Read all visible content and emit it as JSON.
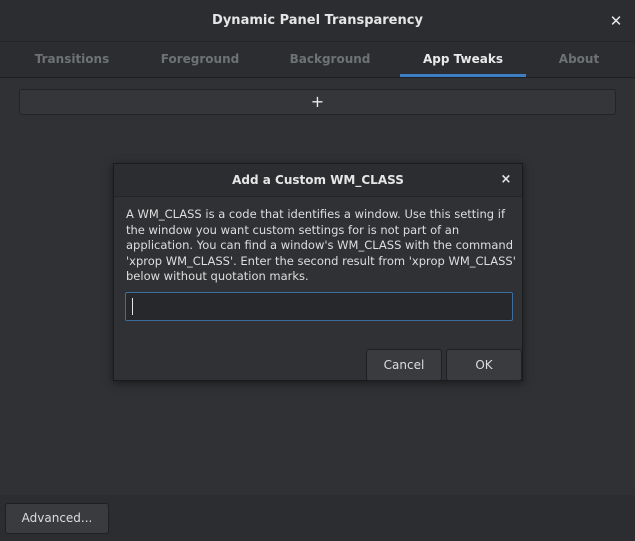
{
  "window": {
    "title": "Dynamic Panel Transparency",
    "close_icon": "close-icon"
  },
  "tabs": [
    {
      "label": "Transitions",
      "active": false
    },
    {
      "label": "Foreground",
      "active": false
    },
    {
      "label": "Background",
      "active": false
    },
    {
      "label": "App Tweaks",
      "active": true
    },
    {
      "label": "About",
      "active": false
    }
  ],
  "content": {
    "add_label": "+"
  },
  "dialog": {
    "title": "Add a Custom WM_CLASS",
    "close_label": "×",
    "message": "A WM_CLASS is a code that identifies a window. Use this setting if the window you want custom settings for is not part of an application. You can find a window's WM_CLASS with the command 'xprop WM_CLASS'. Enter the second result from 'xprop WM_CLASS' below without quotation marks.",
    "input_value": "",
    "input_placeholder": "",
    "cancel_label": "Cancel",
    "ok_label": "OK"
  },
  "footer": {
    "advanced_label": "Advanced..."
  },
  "colors": {
    "accent": "#3e7fc4",
    "background": "#2f3134"
  }
}
